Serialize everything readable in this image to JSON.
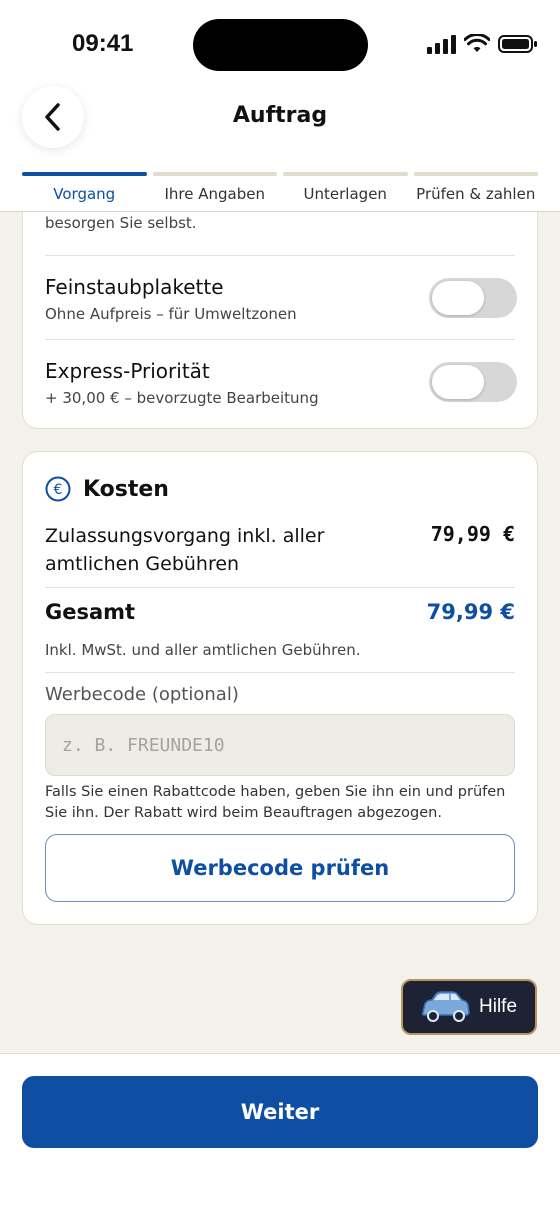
{
  "status": {
    "time": "09:41"
  },
  "header": {
    "title": "Auftrag",
    "back_icon": "chevron-left-icon"
  },
  "tabs": [
    {
      "label": "Vorgang",
      "active": true
    },
    {
      "label": "Ihre Angaben",
      "active": false
    },
    {
      "label": "Unterlagen",
      "active": false
    },
    {
      "label": "Prüfen & zahlen",
      "active": false
    }
  ],
  "options": {
    "partial_text": "besorgen Sie selbst.",
    "items": [
      {
        "title": "Feinstaubplakette",
        "subtitle": "Ohne Aufpreis – für Umweltzonen",
        "enabled": false
      },
      {
        "title": "Express-Priorität",
        "subtitle": "+ 30,00 € – bevorzugte Bearbeitung",
        "enabled": false
      }
    ]
  },
  "costs": {
    "icon": "euro-icon",
    "title": "Kosten",
    "line_label": "Zulassungsvorgang inkl. aller amtlichen Gebühren",
    "line_price": "79,99 €",
    "total_label": "Gesamt",
    "total_value": "79,99 €",
    "note": "Inkl. MwSt. und aller amtlichen Gebühren.",
    "promo_label": "Werbecode (optional)",
    "promo_placeholder": "z. B. FREUNDE10",
    "promo_help": "Falls Sie einen Rabattcode haben, geben Sie ihn ein und prüfen Sie ihn. Der Rabatt wird beim Beauftragen abgezogen.",
    "promo_button": "Werbecode prüfen"
  },
  "help": {
    "label": "Hilfe",
    "icon": "car-icon"
  },
  "footer": {
    "cta": "Weiter"
  },
  "colors": {
    "primary": "#0e4fa3",
    "background": "#f4f2ec",
    "help_bg": "#1e2235"
  }
}
